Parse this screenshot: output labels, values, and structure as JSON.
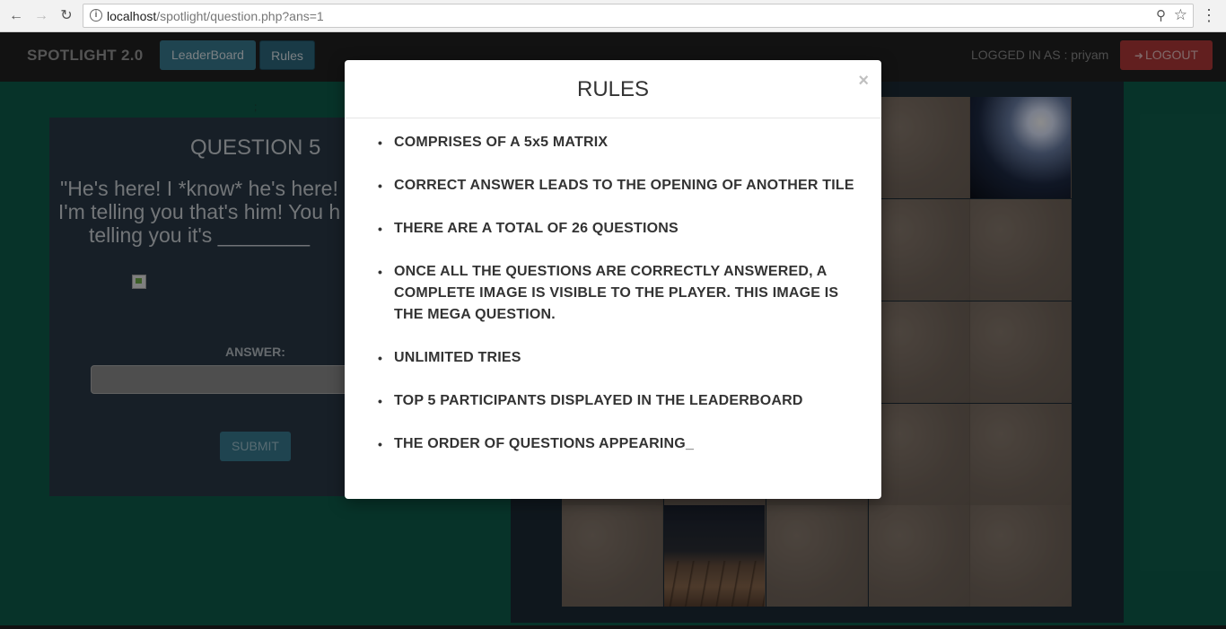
{
  "browser": {
    "host": "localhost",
    "path": "/spotlight/question.php?ans=1"
  },
  "navbar": {
    "brand": "SPOTLIGHT 2.0",
    "leaderboard_label": "LeaderBoard",
    "rules_label": "Rules",
    "logged_in_text": "LOGGED IN AS : priyam",
    "logout_label": "LOGOUT"
  },
  "question": {
    "marker": ";",
    "title": "QUESTION 5",
    "text": "\"He's here! I *know* he's here! I'm telling you that's him! You h telling you it's ________",
    "answer_label": "ANSWER:",
    "answer_value": "",
    "submit_label": "SUBMIT"
  },
  "modal": {
    "title": "RULES",
    "close_glyph": "×",
    "rules": [
      "COMPRISES OF A 5x5 MATRIX",
      "CORRECT ANSWER LEADS TO THE OPENING OF ANOTHER TILE",
      "THERE ARE A TOTAL OF 26 QUESTIONS",
      "ONCE ALL THE QUESTIONS ARE CORRECTLY ANSWERED, A COMPLETE IMAGE IS VISIBLE TO THE PLAYER. THIS IMAGE IS THE MEGA QUESTION.",
      "UNLIMITED TRIES",
      "TOP 5 PARTICIPANTS DISPLAYED IN THE LEADERBOARD",
      "THE ORDER OF QUESTIONS APPEARING_"
    ]
  },
  "colors": {
    "background": "#0e5e4c",
    "navbar": "#222222",
    "panel": "#2a3a47",
    "accent_button": "#3a7c93",
    "logout_button": "#b33a3a"
  }
}
